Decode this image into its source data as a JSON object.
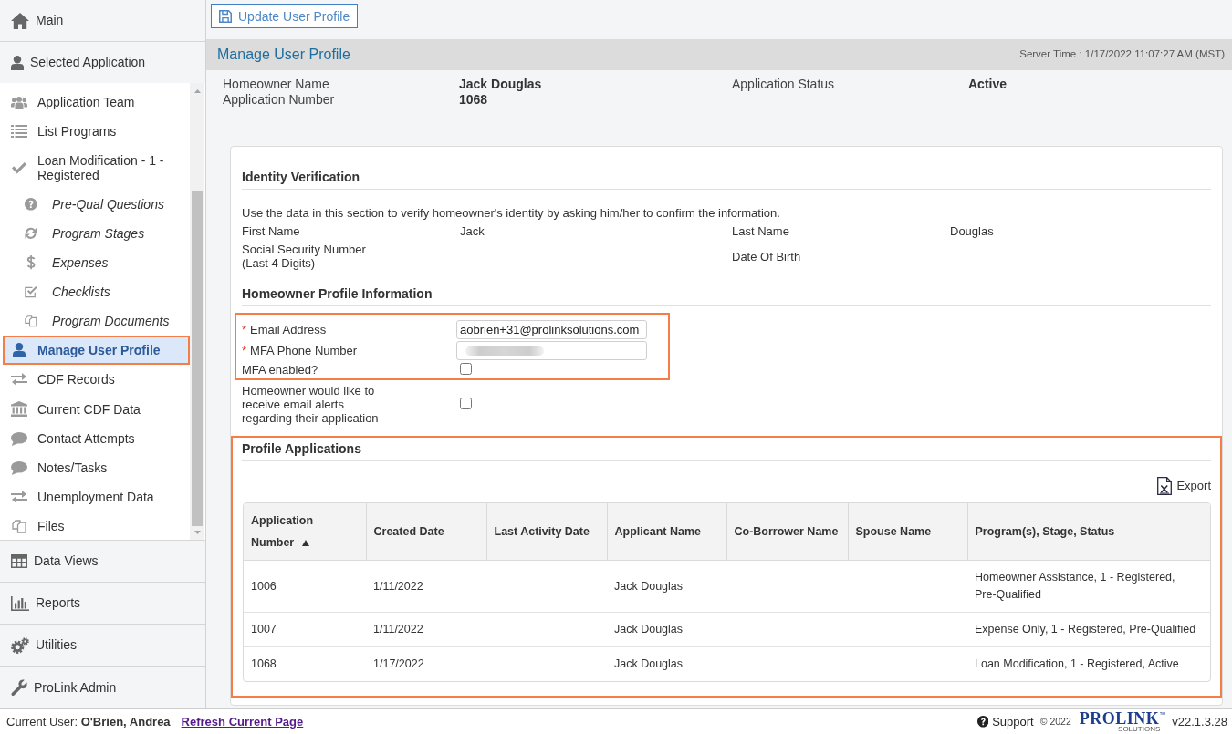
{
  "sidebar": {
    "sections": [
      {
        "label": "Main"
      },
      {
        "label": "Selected Application",
        "items": [
          {
            "label": "Application Team",
            "selected": false
          },
          {
            "label": "List Programs",
            "selected": false
          },
          {
            "label": "Loan Modification - 1 - Registered",
            "selected": false,
            "children": [
              {
                "label": "Pre-Qual Questions",
                "selected": false
              },
              {
                "label": "Program Stages",
                "selected": false
              },
              {
                "label": "Expenses",
                "selected": false
              },
              {
                "label": "Checklists",
                "selected": false
              },
              {
                "label": "Program Documents",
                "selected": false
              }
            ]
          },
          {
            "label": "Manage User Profile",
            "selected": true
          },
          {
            "label": "CDF Records",
            "selected": false
          },
          {
            "label": "Current CDF Data",
            "selected": false
          },
          {
            "label": "Contact Attempts",
            "selected": false
          },
          {
            "label": "Notes/Tasks",
            "selected": false
          },
          {
            "label": "Unemployment Data",
            "selected": false
          },
          {
            "label": "Files",
            "selected": false
          }
        ]
      },
      {
        "label": "Data Views"
      },
      {
        "label": "Reports"
      },
      {
        "label": "Utilities"
      },
      {
        "label": "ProLink Admin"
      }
    ]
  },
  "toolbar": {
    "buttons": [
      {
        "label": "Update User Profile"
      }
    ]
  },
  "page_header": {
    "title": "Manage User Profile",
    "server_time": "Server Time : 1/17/2022 11:07:27 AM (MST)"
  },
  "summary": {
    "rows": [
      [
        {
          "label": "Homeowner Name",
          "value": "Jack Douglas"
        },
        {
          "label": "Application Status",
          "value": "Active"
        }
      ],
      [
        {
          "label": "Application Number",
          "value": "1068"
        }
      ]
    ]
  },
  "identity_verification": {
    "title": "Identity Verification",
    "description": "Use the data in this section to verify homeowner's identity by asking him/her to confirm the information.",
    "rows": [
      [
        {
          "label": "First Name",
          "value": "Jack"
        },
        {
          "label": "Last Name",
          "value": "Douglas"
        }
      ],
      [
        {
          "label": "Social Security Number",
          "note": "(Last 4 Digits)"
        },
        {
          "label": "Date Of Birth"
        }
      ]
    ]
  },
  "homeowner_profile": {
    "title": "Homeowner Profile Information",
    "fields": [
      {
        "kind": "text",
        "required_mark": "*",
        "label": "Email Address",
        "value": "aobrien+31@prolinksolutions.com",
        "highlighted": true
      },
      {
        "kind": "text",
        "required_mark": "*",
        "label": "MFA Phone Number",
        "redacted": true,
        "highlighted": true
      },
      {
        "kind": "checkbox",
        "label": "MFA enabled?",
        "checked": false,
        "highlighted": true
      },
      {
        "kind": "checkbox",
        "label": "Homeowner would like to receive email alerts regarding their application",
        "checked": false,
        "highlighted": false
      }
    ]
  },
  "profile_applications": {
    "title": "Profile Applications",
    "highlighted": true,
    "export": {
      "label": "Export"
    },
    "table": {
      "columns": [
        {
          "label": "Application Number",
          "sort_ascending": true
        },
        {
          "label": "Created Date"
        },
        {
          "label": "Last Activity Date"
        },
        {
          "label": "Applicant Name"
        },
        {
          "label": "Co-Borrower Name"
        },
        {
          "label": "Spouse Name"
        },
        {
          "label": "Program(s), Stage, Status"
        }
      ],
      "rows": [
        {
          "application_number": "1006",
          "created_date": "1/11/2022",
          "applicant_name": "Jack Douglas",
          "programs_stage_status": "Homeowner Assistance, 1 - Registered, Pre-Qualified"
        },
        {
          "application_number": "1007",
          "created_date": "1/11/2022",
          "applicant_name": "Jack Douglas",
          "programs_stage_status": "Expense Only, 1 - Registered, Pre-Qualified"
        },
        {
          "application_number": "1068",
          "created_date": "1/17/2022",
          "applicant_name": "Jack Douglas",
          "programs_stage_status": "Loan Modification, 1 - Registered, Active"
        }
      ]
    }
  },
  "footer": {
    "current_user": "Current User: **O'Brien, Andrea**",
    "refresh_link": "Refresh Current Page",
    "support_link": "Support",
    "copyright": "© 2022",
    "logo": {
      "wordmark": "PROLINK",
      "trademark": "™",
      "tagline": "SOLUTIONS"
    },
    "version": "v22.1.3.28"
  }
}
